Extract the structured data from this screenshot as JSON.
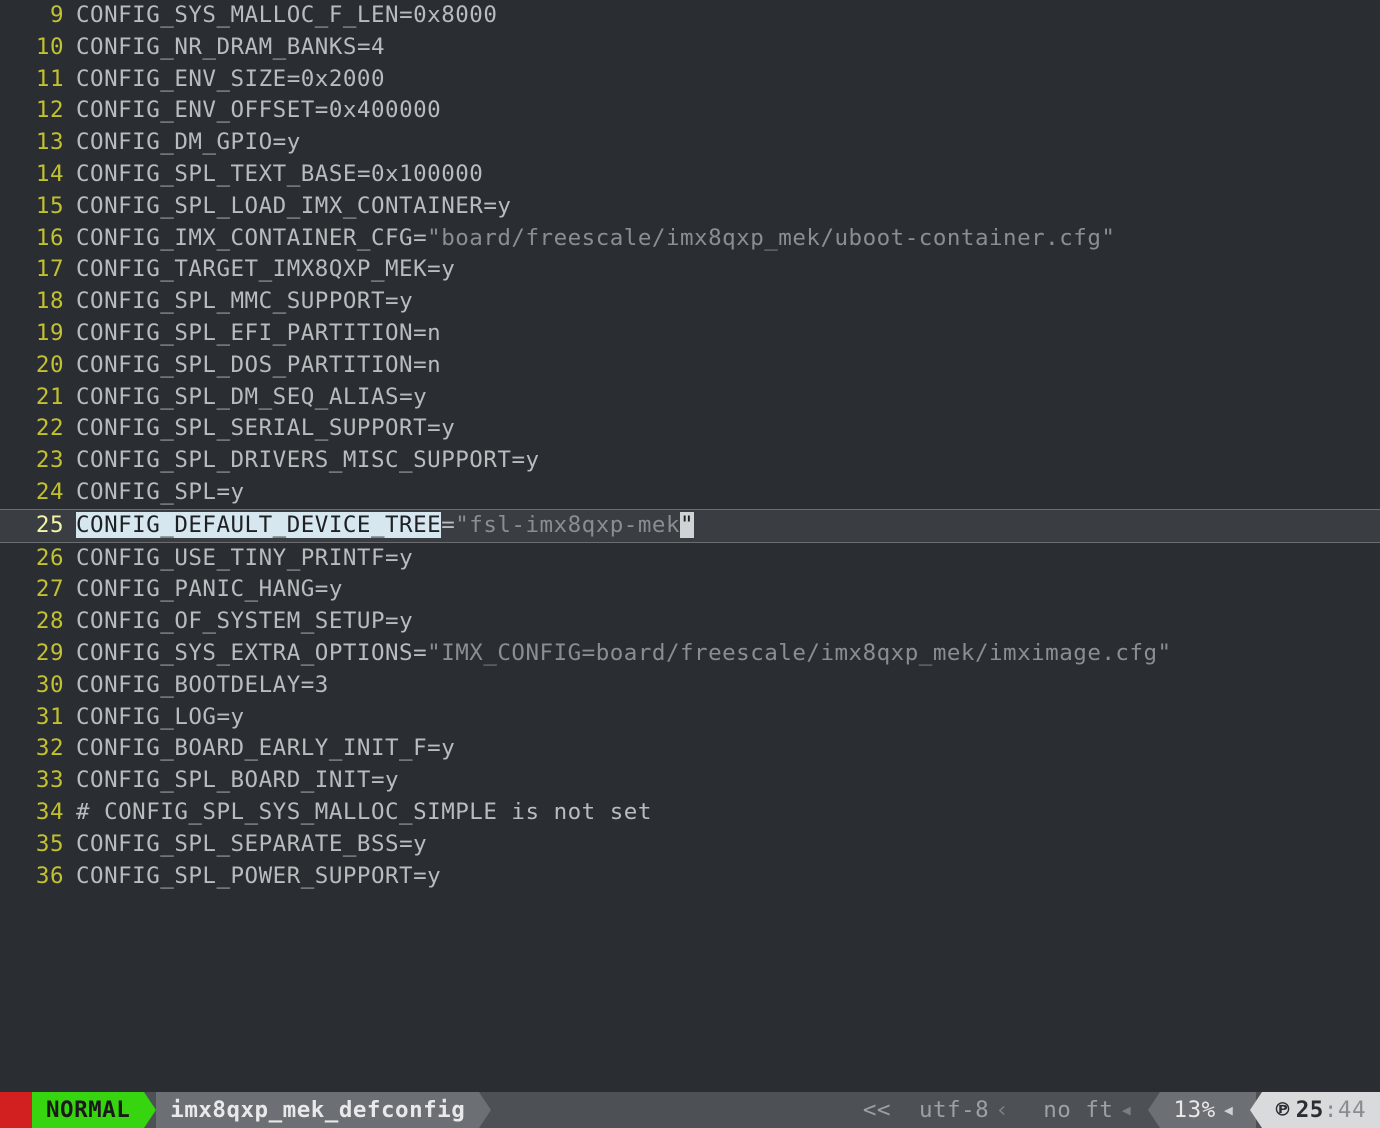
{
  "editor": {
    "cursor_line": 25,
    "search_highlight": "CONFIG_DEFAULT_DEVICE_TREE",
    "lines": [
      {
        "n": 9,
        "k": "CONFIG_SYS_MALLOC_F_LEN",
        "op": "=",
        "v": "0x8000",
        "t": "lit"
      },
      {
        "n": 10,
        "k": "CONFIG_NR_DRAM_BANKS",
        "op": "=",
        "v": "4",
        "t": "lit"
      },
      {
        "n": 11,
        "k": "CONFIG_ENV_SIZE",
        "op": "=",
        "v": "0x2000",
        "t": "lit"
      },
      {
        "n": 12,
        "k": "CONFIG_ENV_OFFSET",
        "op": "=",
        "v": "0x400000",
        "t": "lit"
      },
      {
        "n": 13,
        "k": "CONFIG_DM_GPIO",
        "op": "=",
        "v": "y",
        "t": "lit"
      },
      {
        "n": 14,
        "k": "CONFIG_SPL_TEXT_BASE",
        "op": "=",
        "v": "0x100000",
        "t": "lit"
      },
      {
        "n": 15,
        "k": "CONFIG_SPL_LOAD_IMX_CONTAINER",
        "op": "=",
        "v": "y",
        "t": "lit"
      },
      {
        "n": 16,
        "k": "CONFIG_IMX_CONTAINER_CFG",
        "op": "=",
        "v": "\"board/freescale/imx8qxp_mek/uboot-container.cfg\"",
        "t": "str"
      },
      {
        "n": 17,
        "k": "CONFIG_TARGET_IMX8QXP_MEK",
        "op": "=",
        "v": "y",
        "t": "lit"
      },
      {
        "n": 18,
        "k": "CONFIG_SPL_MMC_SUPPORT",
        "op": "=",
        "v": "y",
        "t": "lit"
      },
      {
        "n": 19,
        "k": "CONFIG_SPL_EFI_PARTITION",
        "op": "=",
        "v": "n",
        "t": "lit"
      },
      {
        "n": 20,
        "k": "CONFIG_SPL_DOS_PARTITION",
        "op": "=",
        "v": "n",
        "t": "lit"
      },
      {
        "n": 21,
        "k": "CONFIG_SPL_DM_SEQ_ALIAS",
        "op": "=",
        "v": "y",
        "t": "lit"
      },
      {
        "n": 22,
        "k": "CONFIG_SPL_SERIAL_SUPPORT",
        "op": "=",
        "v": "y",
        "t": "lit"
      },
      {
        "n": 23,
        "k": "CONFIG_SPL_DRIVERS_MISC_SUPPORT",
        "op": "=",
        "v": "y",
        "t": "lit"
      },
      {
        "n": 24,
        "k": "CONFIG_SPL",
        "op": "=",
        "v": "y",
        "t": "lit"
      },
      {
        "n": 25,
        "k": "CONFIG_DEFAULT_DEVICE_TREE",
        "op": "=",
        "v": "\"fsl-imx8qxp-mek\"",
        "t": "str",
        "cursor_at_end": true
      },
      {
        "n": 26,
        "k": "CONFIG_USE_TINY_PRINTF",
        "op": "=",
        "v": "y",
        "t": "lit"
      },
      {
        "n": 27,
        "k": "CONFIG_PANIC_HANG",
        "op": "=",
        "v": "y",
        "t": "lit"
      },
      {
        "n": 28,
        "k": "CONFIG_OF_SYSTEM_SETUP",
        "op": "=",
        "v": "y",
        "t": "lit"
      },
      {
        "n": 29,
        "k": "CONFIG_SYS_EXTRA_OPTIONS",
        "op": "=",
        "v": "\"IMX_CONFIG=board/freescale/imx8qxp_mek/imximage.cfg\"",
        "t": "str"
      },
      {
        "n": 30,
        "k": "CONFIG_BOOTDELAY",
        "op": "=",
        "v": "3",
        "t": "lit"
      },
      {
        "n": 31,
        "k": "CONFIG_LOG",
        "op": "=",
        "v": "y",
        "t": "lit"
      },
      {
        "n": 32,
        "k": "CONFIG_BOARD_EARLY_INIT_F",
        "op": "=",
        "v": "y",
        "t": "lit"
      },
      {
        "n": 33,
        "k": "CONFIG_SPL_BOARD_INIT",
        "op": "=",
        "v": "y",
        "t": "lit"
      },
      {
        "n": 34,
        "raw": "# CONFIG_SPL_SYS_MALLOC_SIMPLE is not set",
        "t": "comment"
      },
      {
        "n": 35,
        "k": "CONFIG_SPL_SEPARATE_BSS",
        "op": "=",
        "v": "y",
        "t": "lit"
      },
      {
        "n": 36,
        "k": "CONFIG_SPL_POWER_SUPPORT",
        "op": "=",
        "v": "y",
        "t": "lit"
      }
    ]
  },
  "statusline": {
    "mode": "NORMAL",
    "filename": "imx8qxp_mek_defconfig",
    "trailing_ws_indicator": "<<",
    "encoding": "utf-8",
    "filetype": "no ft",
    "percent": "13%",
    "paste_icon": "℗",
    "line": "25",
    "col": "44"
  }
}
